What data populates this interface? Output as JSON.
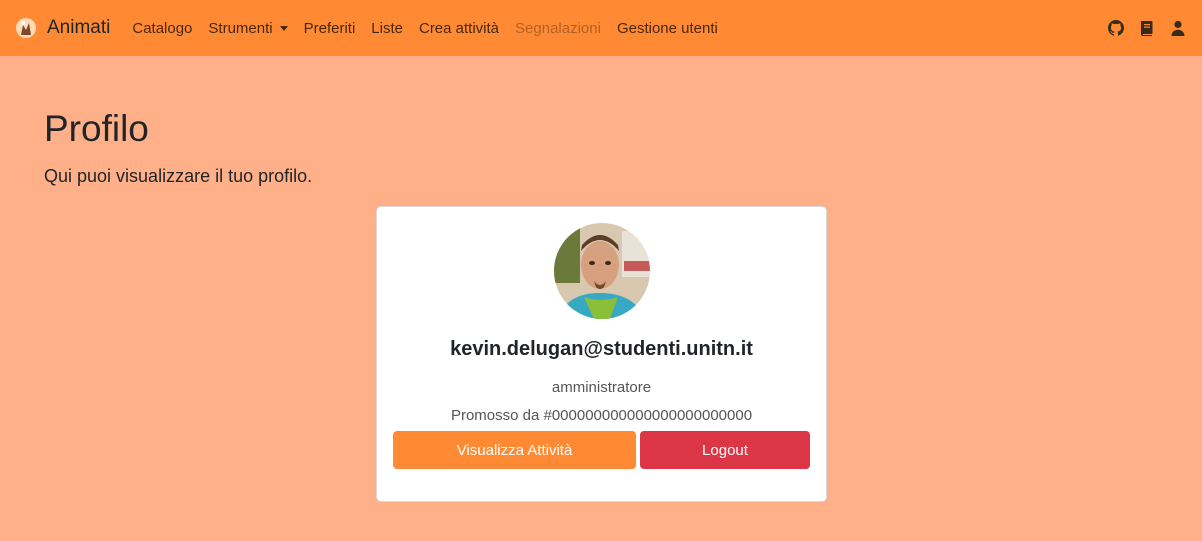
{
  "navbar": {
    "brand": "Animati",
    "items": [
      {
        "label": "Catalogo"
      },
      {
        "label": "Strumenti"
      },
      {
        "label": "Preferiti"
      },
      {
        "label": "Liste"
      },
      {
        "label": "Crea attività"
      },
      {
        "label": "Segnalazioni"
      },
      {
        "label": "Gestione utenti"
      }
    ],
    "right_icons": [
      "github-icon",
      "book-icon",
      "user-icon"
    ]
  },
  "page": {
    "title": "Profilo",
    "lead": "Qui puoi visualizzare il tuo profilo."
  },
  "profile": {
    "email": "kevin.delugan@studenti.unitn.it",
    "role": "amministratore",
    "promoted": "Promosso da #000000000000000000000000",
    "buttons": {
      "activities": "Visualizza Attività",
      "logout": "Logout"
    }
  },
  "colors": {
    "navbar": "#ff8a33",
    "background": "#ffb088",
    "primary": "#ff8a33",
    "danger": "#dc3545"
  }
}
